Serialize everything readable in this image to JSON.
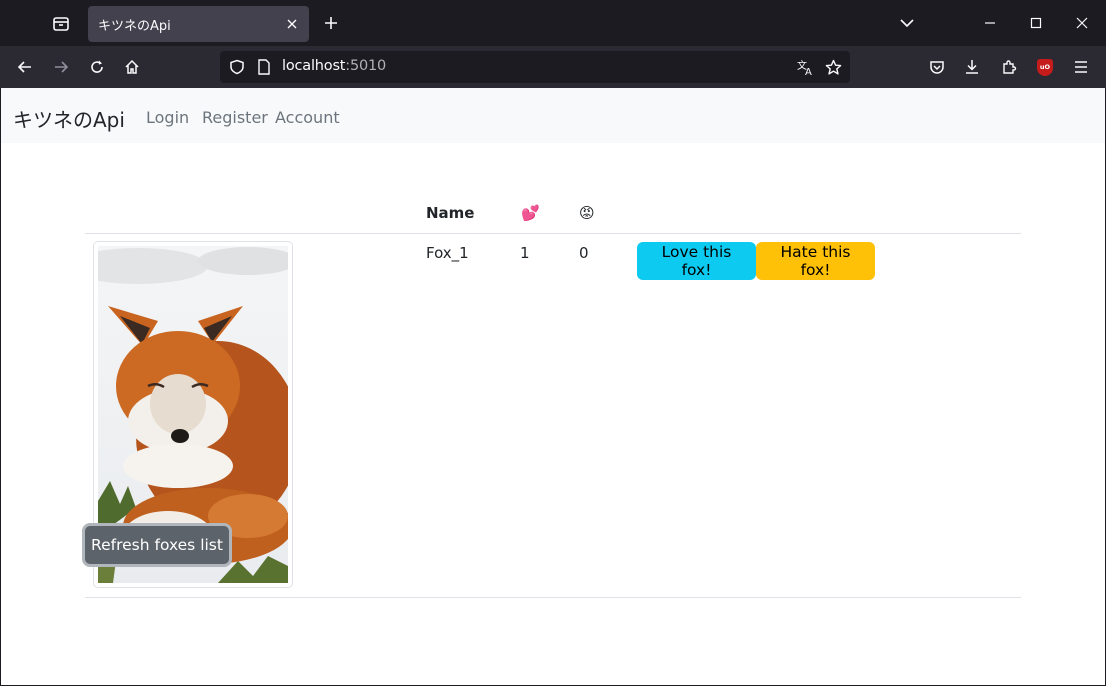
{
  "browser": {
    "tab_title": "キツネのApi",
    "url_host": "localhost",
    "url_port": ":5010"
  },
  "site": {
    "brand": "キツネのApi",
    "nav": [
      "Login",
      "Register",
      "Account"
    ]
  },
  "table": {
    "headers": {
      "name": "Name",
      "loves": "💕",
      "hates": "😡"
    },
    "rows": [
      {
        "name": "Fox_1",
        "loves": "1",
        "hates": "0",
        "love_label": "Love this fox!",
        "hate_label": "Hate this fox!"
      }
    ]
  },
  "refresh_label": "Refresh foxes list",
  "colors": {
    "info": "#0dcaf0",
    "warning": "#ffc107",
    "secondary": "#5c636a"
  }
}
